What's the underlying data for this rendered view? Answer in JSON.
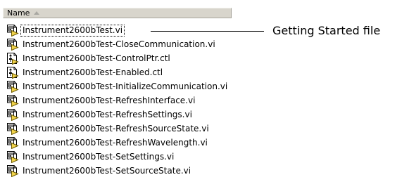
{
  "header": {
    "name_label": "Name"
  },
  "files": [
    {
      "name": "Instrument2600bTest.vi",
      "icon": "vi-file-icon",
      "focused": true
    },
    {
      "name": "Instrument2600bTest-CloseCommunication.vi",
      "icon": "vi-file-icon"
    },
    {
      "name": "Instrument2600bTest-ControlPtr.ctl",
      "icon": "ctl-file-icon"
    },
    {
      "name": "Instrument2600bTest-Enabled.ctl",
      "icon": "ctl-file-icon"
    },
    {
      "name": "Instrument2600bTest-InitializeCommunication.vi",
      "icon": "vi-file-icon"
    },
    {
      "name": "Instrument2600bTest-RefreshInterface.vi",
      "icon": "vi-file-icon"
    },
    {
      "name": "Instrument2600bTest-RefreshSettings.vi",
      "icon": "vi-file-icon"
    },
    {
      "name": "Instrument2600bTest-RefreshSourceState.vi",
      "icon": "vi-file-icon"
    },
    {
      "name": "Instrument2600bTest-RefreshWavelength.vi",
      "icon": "vi-file-icon"
    },
    {
      "name": "Instrument2600bTest-SetSettings.vi",
      "icon": "vi-file-icon"
    },
    {
      "name": "Instrument2600bTest-SetSourceState.vi",
      "icon": "vi-file-icon"
    }
  ],
  "callout": {
    "text": "Getting Started file"
  }
}
